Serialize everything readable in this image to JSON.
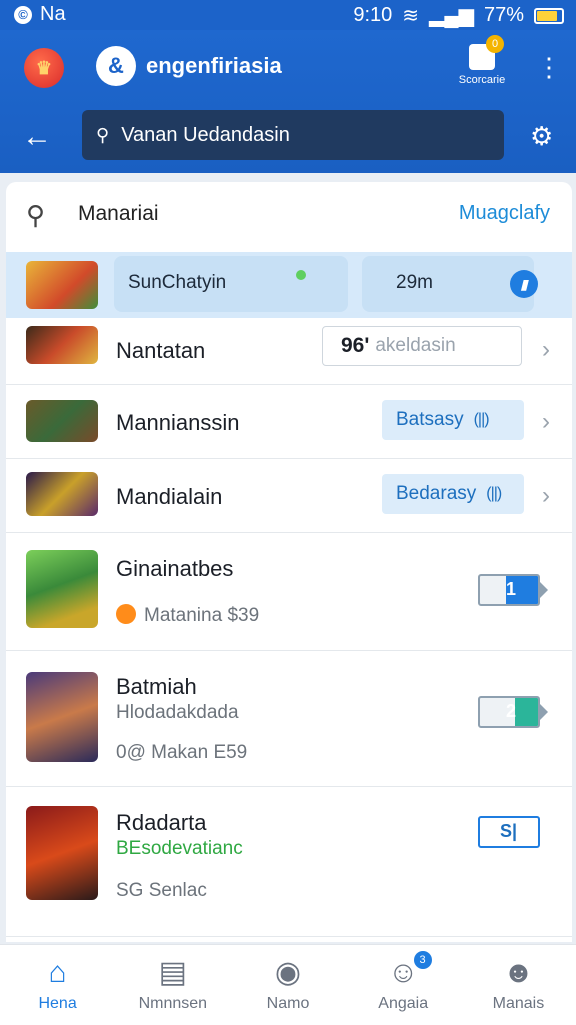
{
  "status": {
    "icon": "©",
    "carrier": "Na",
    "time": "9:10",
    "battery_text": "77%",
    "battery_level": 0.77
  },
  "header": {
    "brand_badge": "&",
    "brand": "engenfiriasia",
    "store_label": "Scorcarie",
    "store_badge": "0"
  },
  "search": {
    "value": "Vanan Uedandasin"
  },
  "list_header": {
    "title": "Manariai",
    "link": "Muagclafy"
  },
  "highlight": {
    "chip_label": "SunChatyin",
    "time": "29m"
  },
  "rows": [
    {
      "name": "Nantatan",
      "pill_prefix": "96'",
      "pill_text": "akeldasin"
    },
    {
      "name": "Mannianssin",
      "pill_text": "Batsasy"
    },
    {
      "name": "Mandialain",
      "pill_text": "Bedarasy"
    }
  ],
  "apps": [
    {
      "name": "Ginainatbes",
      "sub1": "",
      "sub2": "Matanina $39",
      "badge": "1",
      "fill": 0.55,
      "color": "#1f7de0"
    },
    {
      "name": "Batmiah",
      "sub1": "Hlodadakdada",
      "sub2": "0@ Makan E59",
      "badge": "2",
      "fill": 0.4,
      "color": "#2bb59a"
    },
    {
      "name": "Rdadarta",
      "sub1": "BEsodevatianc",
      "sub2": "SG Senlac",
      "badge": "S|",
      "fill": 0.0,
      "color": "#1f7de0"
    }
  ],
  "nav": [
    {
      "label": "Hena",
      "icon": "home-icon"
    },
    {
      "label": "Nmnnsen",
      "icon": "book-icon"
    },
    {
      "label": "Namo",
      "icon": "globe-icon"
    },
    {
      "label": "Angaia",
      "icon": "people-icon",
      "badge": "3"
    },
    {
      "label": "Manais",
      "icon": "person-icon"
    }
  ]
}
